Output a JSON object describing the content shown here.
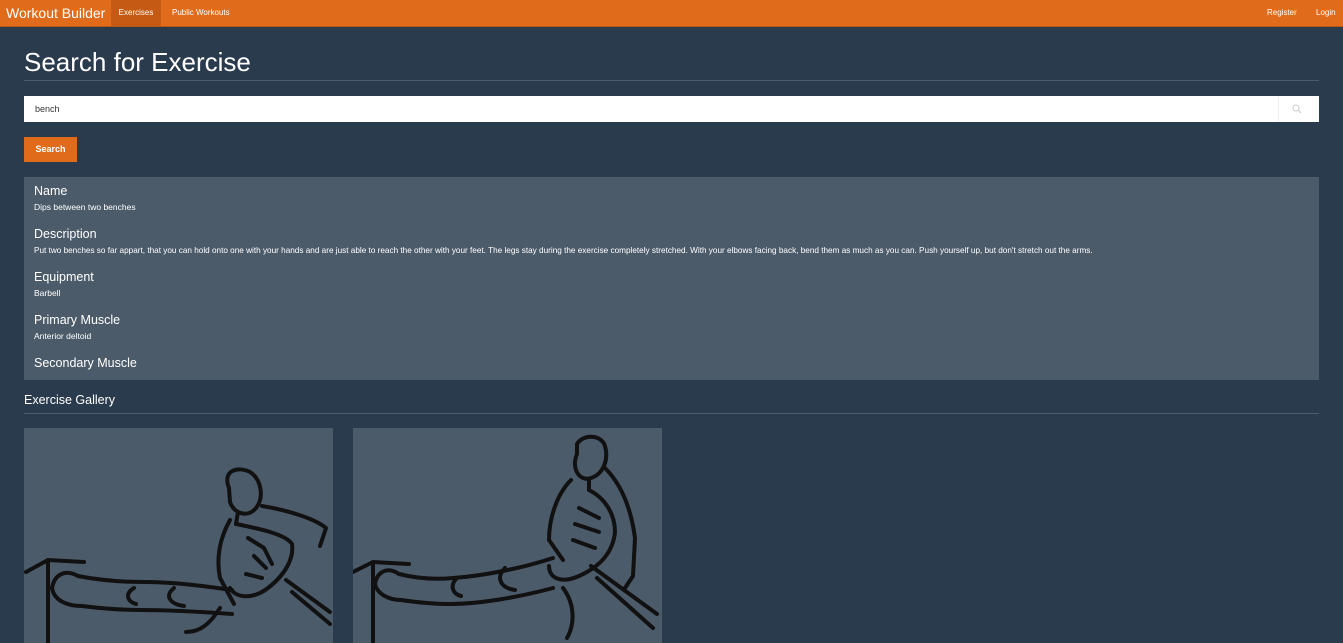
{
  "navbar": {
    "brand": "Workout Builder",
    "links": [
      "Exercises",
      "Public Workouts"
    ],
    "right_links": [
      "Register",
      "Login"
    ],
    "accent_color": "#e06c1b"
  },
  "page": {
    "title": "Search for Exercise"
  },
  "search": {
    "value": "bench",
    "icon": "search-icon",
    "button_label": "Search"
  },
  "exercise": {
    "name_label": "Name",
    "name": "Dips between two benches",
    "description_label": "Description",
    "description": "Put two benches so far appart, that you can hold onto one with your hands and are just able to reach the other with your feet. The legs stay during the exercise completely stretched. With your elbows facing back, bend them as much as you can. Push yourself up, but don't stretch out the arms.",
    "equipment_label": "Equipment",
    "equipment": "Barbell",
    "primary_muscle_label": "Primary Muscle",
    "primary_muscle": "Anterior deltoid",
    "secondary_muscle_label": "Secondary Muscle",
    "secondary_muscle": ""
  },
  "gallery": {
    "title": "Exercise Gallery",
    "images": [
      "bench-dip-lowered-illustration",
      "bench-dip-raised-illustration"
    ]
  }
}
